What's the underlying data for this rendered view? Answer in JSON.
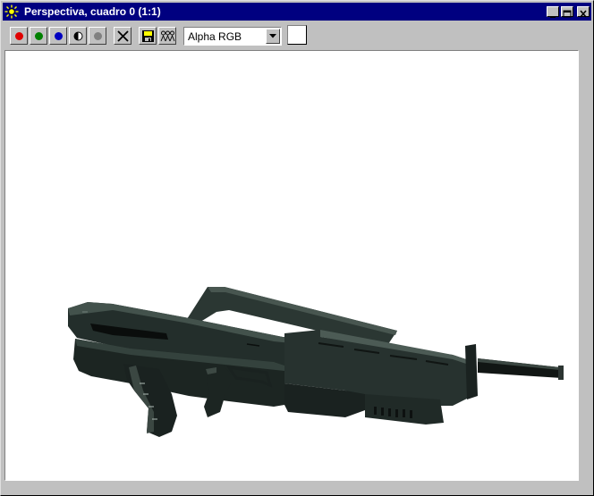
{
  "window": {
    "title": "Perspectiva, cuadro 0 (1:1)"
  },
  "toolbar": {
    "channel_buttons": [
      {
        "name": "red-channel",
        "color": "#e00000"
      },
      {
        "name": "green-channel",
        "color": "#008000"
      },
      {
        "name": "blue-channel",
        "color": "#0000c0"
      }
    ],
    "mono_color": "#808080",
    "channel_select": {
      "value": "Alpha RGB"
    },
    "background_swatch_color": "#ffffff"
  },
  "viewport": {
    "content": "rendered-rifle-model"
  }
}
